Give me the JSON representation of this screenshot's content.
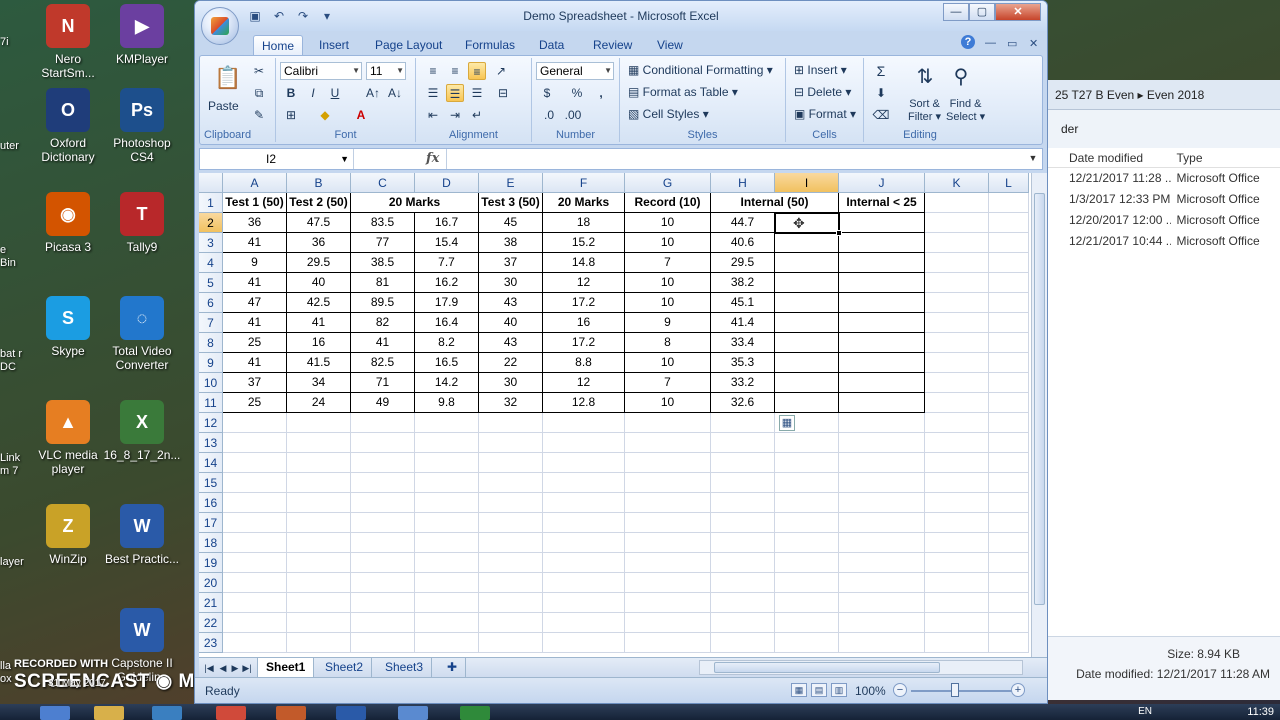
{
  "window": {
    "title": "Demo Spreadsheet - Microsoft Excel"
  },
  "ribbon": {
    "tabs": [
      "Home",
      "Insert",
      "Page Layout",
      "Formulas",
      "Data",
      "Review",
      "View"
    ],
    "active_tab": "Home",
    "clipboard": {
      "label": "Clipboard",
      "paste": "Paste"
    },
    "font": {
      "label": "Font",
      "family": "Calibri",
      "size": "11"
    },
    "alignment": {
      "label": "Alignment"
    },
    "number": {
      "label": "Number",
      "format": "General",
      "currency": "$",
      "percent": "%",
      "comma": ","
    },
    "styles": {
      "label": "Styles",
      "conditional": "Conditional Formatting",
      "table": "Format as Table",
      "cell_styles": "Cell Styles"
    },
    "cells": {
      "label": "Cells",
      "insert": "Insert",
      "delete": "Delete",
      "format": "Format"
    },
    "editing": {
      "label": "Editing",
      "sort": "Sort &",
      "filter": "Filter",
      "find": "Find &",
      "select": "Select"
    }
  },
  "formula_bar": {
    "name_box": "I2",
    "fx": "fx",
    "content": ""
  },
  "grid": {
    "columns": [
      "A",
      "B",
      "C",
      "D",
      "E",
      "F",
      "G",
      "H",
      "I",
      "J",
      "K",
      "L"
    ],
    "selected_column": "I",
    "selected_row": 2,
    "rows": [
      [
        "Test 1 (50)",
        "Test 2 (50)",
        "20 Marks",
        "",
        "Test 3 (50)",
        "20 Marks",
        "Record (10)",
        "Internal (50)",
        "",
        "Internal < 25",
        "",
        ""
      ],
      [
        "36",
        "47.5",
        "83.5",
        "16.7",
        "45",
        "18",
        "10",
        "44.7",
        "",
        "",
        "",
        ""
      ],
      [
        "41",
        "36",
        "77",
        "15.4",
        "38",
        "15.2",
        "10",
        "40.6",
        "",
        "",
        "",
        ""
      ],
      [
        "9",
        "29.5",
        "38.5",
        "7.7",
        "37",
        "14.8",
        "7",
        "29.5",
        "",
        "",
        "",
        ""
      ],
      [
        "41",
        "40",
        "81",
        "16.2",
        "30",
        "12",
        "10",
        "38.2",
        "",
        "",
        "",
        ""
      ],
      [
        "47",
        "42.5",
        "89.5",
        "17.9",
        "43",
        "17.2",
        "10",
        "45.1",
        "",
        "",
        "",
        ""
      ],
      [
        "41",
        "41",
        "82",
        "16.4",
        "40",
        "16",
        "9",
        "41.4",
        "",
        "",
        "",
        ""
      ],
      [
        "25",
        "16",
        "41",
        "8.2",
        "43",
        "17.2",
        "8",
        "33.4",
        "",
        "",
        "",
        ""
      ],
      [
        "41",
        "41.5",
        "82.5",
        "16.5",
        "22",
        "8.8",
        "10",
        "35.3",
        "",
        "",
        "",
        ""
      ],
      [
        "37",
        "34",
        "71",
        "14.2",
        "30",
        "12",
        "7",
        "33.2",
        "",
        "",
        "",
        ""
      ],
      [
        "25",
        "24",
        "49",
        "9.8",
        "32",
        "12.8",
        "10",
        "32.6",
        "",
        "",
        "",
        ""
      ]
    ],
    "row_count": 23
  },
  "sheets": {
    "tabs": [
      "Sheet1",
      "Sheet2",
      "Sheet3"
    ],
    "active": "Sheet1"
  },
  "status_bar": {
    "text": "Ready",
    "zoom": "100%"
  },
  "explorer": {
    "breadcrumb": "25 T27 B Even  ▸  Even 2018",
    "subheader": "der",
    "columns": [
      "Date modified",
      "Type"
    ],
    "files": [
      {
        "date": "12/21/2017 11:28 ...",
        "type": "Microsoft Office"
      },
      {
        "date": "1/3/2017 12:33 PM",
        "type": "Microsoft Office"
      },
      {
        "date": "12/20/2017 12:00 ...",
        "type": "Microsoft Office"
      },
      {
        "date": "12/21/2017 10:44 ...",
        "type": "Microsoft Office"
      }
    ],
    "size": "Size: 8.94 KB",
    "modified": "Date modified: 12/21/2017 11:28 AM"
  },
  "desktop_icons": [
    {
      "label": "Nero StartSm...",
      "color": "#c0392b",
      "glyph": "N"
    },
    {
      "label": "KMPlayer",
      "color": "#6b3fa0",
      "glyph": "▶"
    },
    {
      "label": "Oxford Dictionary",
      "color": "#1f3d7a",
      "glyph": "O"
    },
    {
      "label": "Photoshop CS4",
      "color": "#1d4f8c",
      "glyph": "Ps"
    },
    {
      "label": "Picasa 3",
      "color": "#d35400",
      "glyph": "◉"
    },
    {
      "label": "Tally9",
      "color": "#b8282a",
      "glyph": "T"
    },
    {
      "label": "Skype",
      "color": "#1b9de2",
      "glyph": "S"
    },
    {
      "label": "Total Video Converter",
      "color": "#2277cc",
      "glyph": "◌"
    },
    {
      "label": "VLC media player",
      "color": "#e67e22",
      "glyph": "▲"
    },
    {
      "label": "16_8_17_2n...",
      "color": "#3a7a3a",
      "glyph": "X"
    },
    {
      "label": "WinZip",
      "color": "#c9a227",
      "glyph": "Z"
    },
    {
      "label": "Best Practic...",
      "color": "#2a5aa8",
      "glyph": "W"
    },
    {
      "label": "Capstone II Guideline",
      "color": "#2a5aa8",
      "glyph": "W"
    }
  ],
  "desktop_edge_labels": [
    "7i",
    "uter",
    "e Bin",
    "bat r DC",
    "Link m 7",
    "layer",
    "lla ox"
  ],
  "watermark": {
    "line1": "RECORDED WITH",
    "line2": "SCREENCAST  ◉  MATIC",
    "date": "31 May 2017"
  },
  "taskbar": {
    "lang": "EN",
    "clock": "11:39"
  }
}
